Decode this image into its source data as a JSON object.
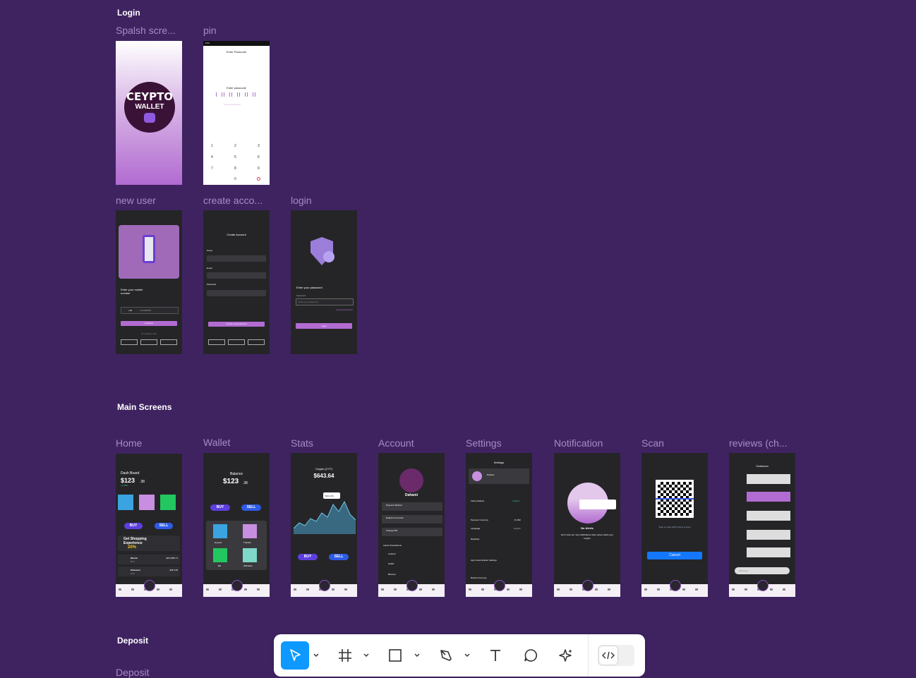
{
  "sections": {
    "login": "Login",
    "main": "Main Screens",
    "deposit": "Deposit"
  },
  "frames": {
    "splash": "Spalsh scre...",
    "pin": "pin",
    "new_user": "new user",
    "create_account": "create acco...",
    "login": "login",
    "home": "Home",
    "wallet": "Wallet",
    "stats": "Stats",
    "account": "Account",
    "settings": "Settings",
    "notification": "Notification",
    "scan": "Scan",
    "reviews": "reviews (ch...",
    "deposit": "Deposit"
  },
  "splash": {
    "line1": "CEYPTO",
    "line2": "WALLET"
  },
  "pin": {
    "time": "9:41",
    "title": "Enter Passcode",
    "subtitle": "Enter passcode",
    "forgot": "Forgot passcode?",
    "keys": [
      "1",
      "2",
      "3",
      "4",
      "5",
      "6",
      "7",
      "8",
      "9",
      "0"
    ]
  },
  "new_user": {
    "prompt": "Enter your mobile number",
    "country": "+94",
    "number": "71-2345678",
    "button": "Continue",
    "or": "Or continue with"
  },
  "create_account": {
    "title": "Create Account",
    "name": "Name",
    "email": "Email",
    "password": "Password",
    "button": "Create a new account"
  },
  "login": {
    "title": "Enter your password",
    "field": "Password",
    "placeholder": "Enter your password",
    "forgot": "Forgot password?",
    "button": "Login"
  },
  "home": {
    "title": "Dash Board",
    "balance": "$123",
    "cents": ".38",
    "change": "+7.95%",
    "buy": "BUY",
    "sell": "SELL",
    "promo1": "Get Shopping",
    "promo2": "Experience",
    "promo3": "20%",
    "coins": [
      {
        "name": "Bitcoin",
        "code": "BTC",
        "value": "$213,895.71"
      },
      {
        "name": "Ethereum",
        "code": "ETH",
        "value": "$35,5.68"
      }
    ]
  },
  "wallet": {
    "title": "Balance",
    "balance": "$123",
    "cents": ".38",
    "buy": "BUY",
    "sell": "SELL",
    "items": [
      "Deposit",
      "Transfer",
      "Bill",
      "Withdraw"
    ]
  },
  "stats": {
    "title": "Ceypto (CYT)",
    "value": "$643.64",
    "tooltip": "$94,2.84",
    "buy": "BUY",
    "sell": "SELL"
  },
  "account": {
    "name": "Dahami",
    "items": [
      "Payment Method",
      "Default Currencies",
      "Change PIN"
    ],
    "latest": "Latest Transactions",
    "tx": [
      "Amazon",
      "Netflix",
      "Binance"
    ]
  },
  "settings": {
    "title": "Settings",
    "user": "Dahami",
    "rows": [
      "Verify Address",
      "Payment Currency",
      "Language",
      "Day/Help",
      "App Customization Settings",
      "Refund Currency"
    ],
    "verified": "verified",
    "currency": "$ USD",
    "language": "English"
  },
  "notification": {
    "title": "No Alerts",
    "text": "Don't miss out. Get notifications when prices reach your targets"
  },
  "scan": {
    "caption": "Align qr code within frame to scan",
    "button": "Cancel"
  },
  "reviews": {
    "title": "Chatroom",
    "placeholder": "Message..."
  },
  "toolbar": {
    "active": "move-tool"
  },
  "colors": {
    "background": "#3f2361",
    "accent": "#b26bd1",
    "button_blue": "#1477ff",
    "toolbar_active": "#0d99ff"
  }
}
